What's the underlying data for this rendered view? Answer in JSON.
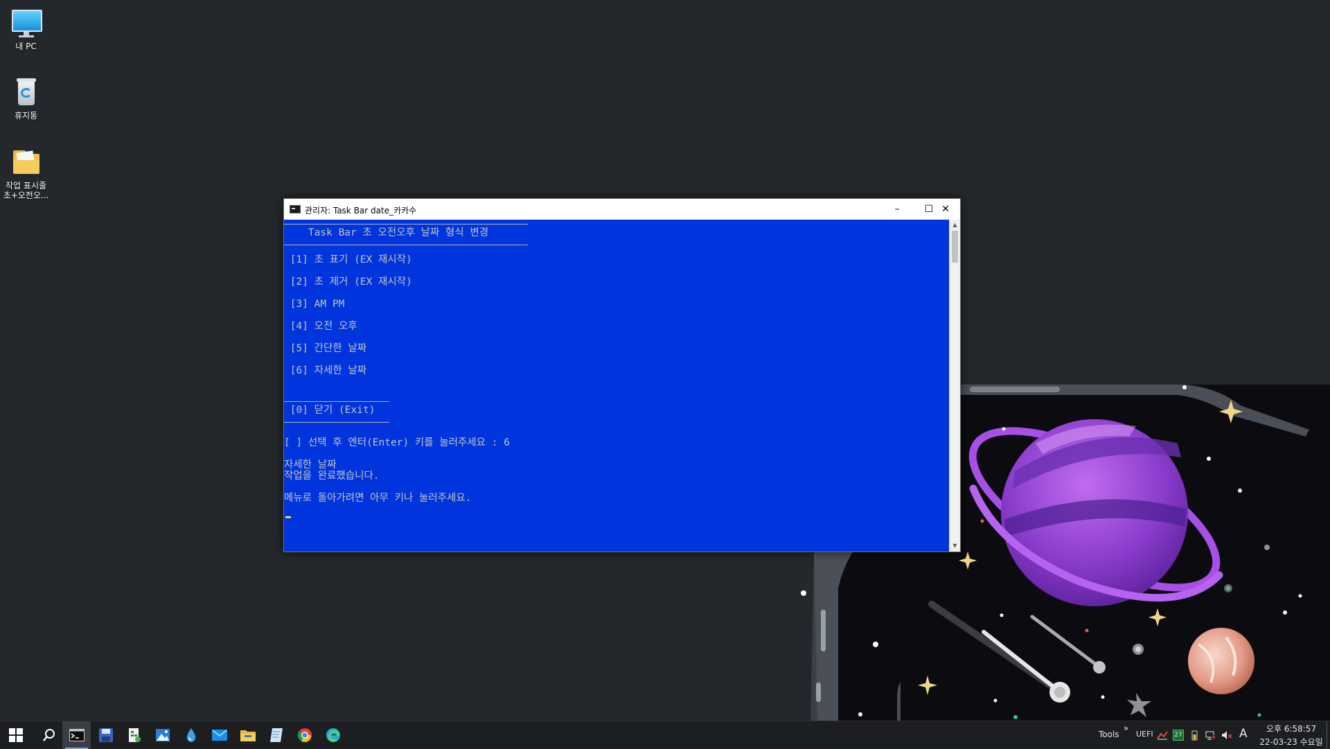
{
  "desktop": {
    "icons": [
      {
        "label": "내 PC",
        "icon": "monitor-icon"
      },
      {
        "label": "휴지통",
        "icon": "recycle-bin-icon"
      },
      {
        "label_line1": "작업 표시줄",
        "label_line2": "초+오전오...",
        "icon": "folder-icon"
      }
    ]
  },
  "console": {
    "title": "관리자:  Task Bar date_카카수",
    "controls": {
      "minimize": "–",
      "maximize": "☐",
      "close": "✕"
    },
    "header": "    Task Bar 초 오전오후 날짜 형식 변경",
    "menu": [
      " [1] 초 표기 (EX 재시작)",
      " [2] 초 제거 (EX 재시작)",
      " [3] AM PM",
      " [4] 오전 오후",
      " [5] 간단한 날짜",
      " [6] 자세한 날짜"
    ],
    "exit_item": " [0] 닫기 (Exit)",
    "prompt": "[ ] 선택 후 엔터(Enter) 키를 눌러주세요 : 6",
    "output": [
      "자세한 날짜",
      "작업을 완료했습니다.",
      "메뉴로 돌아가려면 아무 키나 눌러주세요."
    ],
    "colors": {
      "background": "#0035dd",
      "text": "#c4c4c4"
    }
  },
  "taskbar": {
    "pinned": [
      {
        "name": "start-button",
        "icon": "windows-logo-icon"
      },
      {
        "name": "search-button",
        "icon": "search-icon"
      },
      {
        "name": "cmd-button",
        "icon": "terminal-icon",
        "active": true
      },
      {
        "name": "save-app-button",
        "icon": "floppy-icon"
      },
      {
        "name": "sheet-app-button",
        "icon": "spreadsheet-icon"
      },
      {
        "name": "photos-button",
        "icon": "picture-icon"
      },
      {
        "name": "drop-app-button",
        "icon": "droplet-icon"
      },
      {
        "name": "mail-button",
        "icon": "mail-icon"
      },
      {
        "name": "explorer-button",
        "icon": "folder-icon"
      },
      {
        "name": "notepad-button",
        "icon": "notepad-icon"
      },
      {
        "name": "chrome-button",
        "icon": "chrome-icon"
      },
      {
        "name": "edge-button",
        "icon": "edge-icon"
      }
    ],
    "tray": {
      "tools_label": "Tools",
      "overflow": "»",
      "uefi_label": "UEFI",
      "badge": "27",
      "ime": "A",
      "time": "오후 6:58:57",
      "date": "22-03-23 수요일"
    }
  }
}
